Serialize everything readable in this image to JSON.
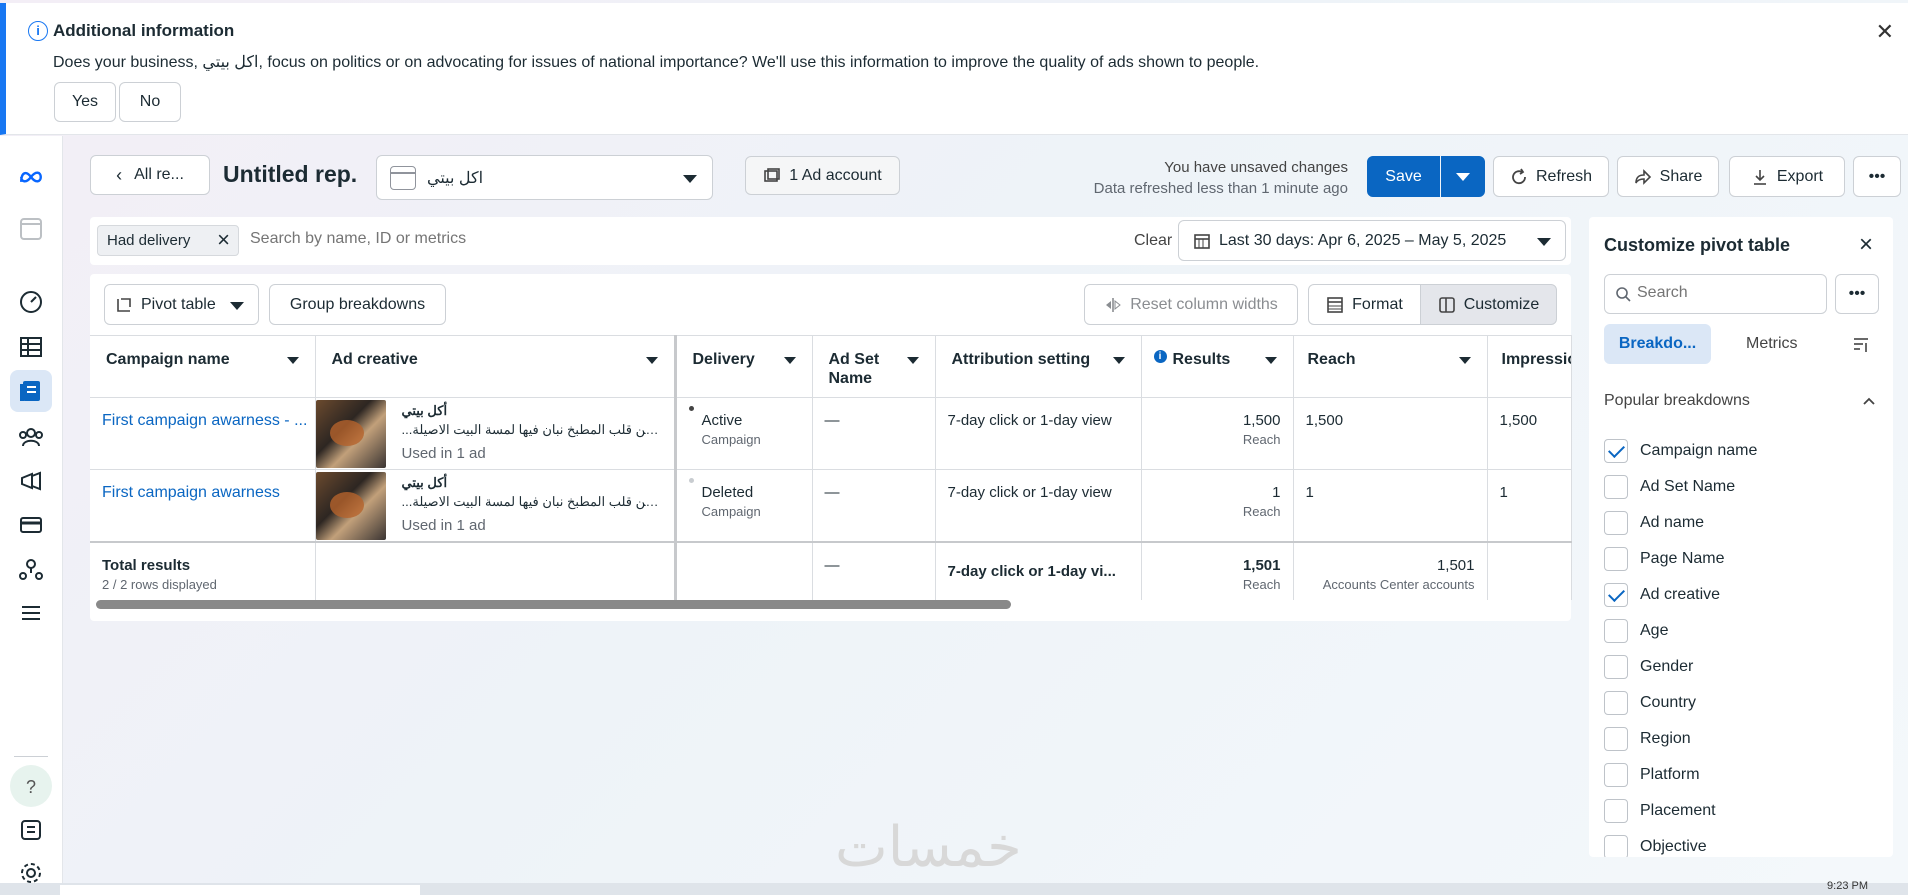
{
  "banner": {
    "title": "Additional information",
    "text": "Does your business, اكل بيتي, focus on politics or on advocating for issues of national importance? We'll use this information to improve the quality of ads shown to people.",
    "yes": "Yes",
    "no": "No",
    "close": "✕"
  },
  "toolbar": {
    "back_label": "All re...",
    "report_title": "Untitled rep.",
    "account_name": "اكل بيتي",
    "ad_account_label": "1 Ad account",
    "unsaved": "You have unsaved changes",
    "refreshed": "Data refreshed less than 1 minute ago",
    "save": "Save",
    "refresh": "Refresh",
    "share": "Share",
    "export": "Export",
    "more": "•••"
  },
  "filter": {
    "chip": "Had delivery",
    "search_placeholder": "Search by name, ID or metrics",
    "clear": "Clear",
    "date_range": "Last 30 days: Apr 6, 2025 – May 5, 2025"
  },
  "panel": {
    "pivot": "Pivot table",
    "group": "Group breakdowns",
    "reset": "Reset column widths",
    "format": "Format",
    "customize": "Customize"
  },
  "table": {
    "headers": [
      "Campaign name",
      "Ad creative",
      "Delivery",
      "Ad Set Name",
      "Attribution setting",
      "Results",
      "Reach",
      "Impressio"
    ],
    "rows": [
      {
        "campaign": "First campaign awarness - ...",
        "creative_title": "أكل بيتي",
        "creative_desc": "...اكتا من قلب المطبخ نبان فيها لمسة البيت الاصيلة",
        "creative_used": "Used in 1 ad",
        "delivery": "Active",
        "delivery_sub": "Campaign",
        "adset": "—",
        "attribution": "7-day click or 1-day view",
        "results": "1,500",
        "results_sub": "Reach",
        "reach": "1,500",
        "impressions": "1,500"
      },
      {
        "campaign": "First campaign awarness",
        "creative_title": "أكل بيتي",
        "creative_desc": "...اكتا من قلب المطبخ نبان فيها لمسة البيت الاصيلة",
        "creative_used": "Used in 1 ad",
        "delivery": "Deleted",
        "delivery_sub": "Campaign",
        "adset": "—",
        "attribution": "7-day click or 1-day view",
        "results": "1",
        "results_sub": "Reach",
        "reach": "1",
        "impressions": "1"
      }
    ],
    "total": {
      "label": "Total results",
      "sub": "2 / 2 rows displayed",
      "adset": "—",
      "attribution": "7-day click or 1-day vi...",
      "results": "1,501",
      "results_sub": "Reach",
      "reach": "1,501",
      "reach_sub": "Accounts Center accounts"
    }
  },
  "customize": {
    "title": "Customize pivot table",
    "search_placeholder": "Search",
    "tab_breakdowns": "Breakdo...",
    "tab_metrics": "Metrics",
    "section": "Popular breakdowns",
    "items": [
      {
        "label": "Campaign name",
        "checked": true
      },
      {
        "label": "Ad Set Name",
        "checked": false
      },
      {
        "label": "Ad name",
        "checked": false
      },
      {
        "label": "Page Name",
        "checked": false
      },
      {
        "label": "Ad creative",
        "checked": true
      },
      {
        "label": "Age",
        "checked": false
      },
      {
        "label": "Gender",
        "checked": false
      },
      {
        "label": "Country",
        "checked": false
      },
      {
        "label": "Region",
        "checked": false
      },
      {
        "label": "Platform",
        "checked": false
      },
      {
        "label": "Placement",
        "checked": false
      },
      {
        "label": "Objective",
        "checked": false
      }
    ]
  },
  "watermark": "خمسات",
  "taskbar_time": "9:23 PM",
  "colors": {
    "primary": "#0a66c2",
    "banner_accent": "#1877f2",
    "meta_blue": "#0866ff"
  }
}
